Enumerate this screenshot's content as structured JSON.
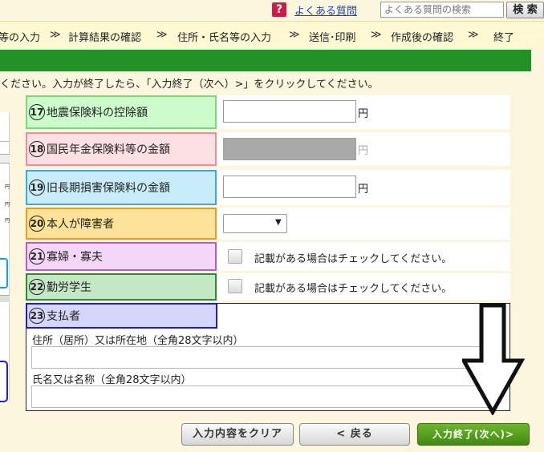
{
  "header": {
    "help_icon": "?",
    "faq_link": "よくある質問",
    "search_placeholder": "よくある質問の検索",
    "search_button": "検 索"
  },
  "steps": [
    "等の入力",
    "計算結果の確認",
    "住所・氏名等の入力",
    "送信･印刷",
    "作成後の確認",
    "終了"
  ],
  "step_separator": "≫",
  "instruction": "ください。入力が終了したら、「入力終了（次へ）>」をクリックしてください。",
  "rows": [
    {
      "num": "17",
      "label": "地震保険料の控除額",
      "unit": "円"
    },
    {
      "num": "18",
      "label": "国民年金保険料等の金額",
      "unit": "円"
    },
    {
      "num": "19",
      "label": "旧長期損害保険料の金額",
      "unit": "円"
    },
    {
      "num": "20",
      "label": "本人が障害者",
      "select_value": "",
      "select_arrow": "▼"
    },
    {
      "num": "21",
      "label": "寡婦・寡夫",
      "checkbox_text": "記載がある場合はチェックしてください。"
    },
    {
      "num": "22",
      "label": "勤労学生",
      "checkbox_text": "記載がある場合はチェックしてください。"
    },
    {
      "num": "23",
      "label": "支払者",
      "address_label": "住所（居所）又は所在地（全角28文字以内）",
      "name_label": "氏名又は名称（全角28文字以内）"
    }
  ],
  "left_marks": [
    "円",
    "円",
    "円"
  ],
  "buttons": {
    "clear": "入力内容をクリア",
    "back": "<  戻る",
    "next": "入力終了(次へ)>"
  },
  "colors": {
    "row17": "#ccfbcc",
    "row17_border": "#7fd47f",
    "row18": "#fde0e4",
    "row18_border": "#e8909c",
    "row19": "#c9ecfb",
    "row19_border": "#3ea7e0",
    "row20": "#fde39a",
    "row20_border": "#e0a020",
    "row21": "#f4d6f8",
    "row21_border": "#b060c8",
    "row22": "#c6e7c6",
    "row22_border": "#2f8a2f",
    "row23": "#d6d6fb",
    "row23_border": "#1c1cc8"
  }
}
